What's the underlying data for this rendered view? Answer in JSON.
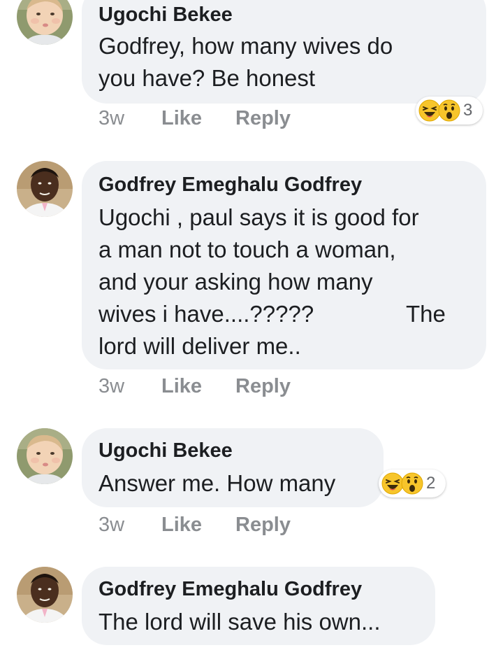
{
  "comments": [
    {
      "author": "Ugochi Bekee",
      "lines": [
        "Godfrey, how many wives do",
        "you have? Be honest"
      ],
      "time": "3w",
      "like_label": "Like",
      "reply_label": "Reply",
      "reactions": {
        "icons": [
          "laughing-emoji",
          "wow-emoji"
        ],
        "count": "3"
      }
    },
    {
      "author": "Godfrey Emeghalu Godfrey",
      "lines": [
        "Ugochi , paul says it is good for",
        "a man not to touch a woman,",
        "and your asking how many",
        "wives i have....?????",
        "lord will deliver me.."
      ],
      "line4_extra": "The",
      "time": "3w",
      "like_label": "Like",
      "reply_label": "Reply"
    },
    {
      "author": "Ugochi Bekee",
      "lines": [
        "Answer me. How many"
      ],
      "time": "3w",
      "like_label": "Like",
      "reply_label": "Reply",
      "reactions": {
        "icons": [
          "laughing-emoji",
          "wow-emoji"
        ],
        "count": "2"
      }
    },
    {
      "author": "Godfrey Emeghalu Godfrey",
      "lines": [
        "The lord will save his own..."
      ]
    }
  ],
  "colors": {
    "bubble": "#f0f2f5",
    "text": "#1c1e21",
    "meta": "#8a8d91",
    "emoji_yellow": "#f7c52b"
  }
}
